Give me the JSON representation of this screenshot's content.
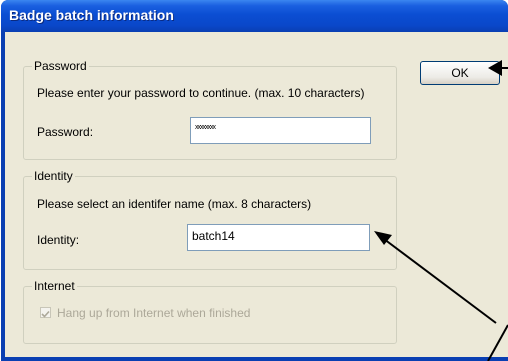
{
  "dialog": {
    "title": "Badge batch information"
  },
  "ok_button": {
    "label": "OK"
  },
  "password_group": {
    "legend": "Password",
    "instruction": "Please enter your password to continue. (max. 10 characters)",
    "field_label": "Password:",
    "value_masked": "xxxxxxxx"
  },
  "identity_group": {
    "legend": "Identity",
    "instruction": "Please select an identifer name (max. 8 characters)",
    "field_label": "Identity:",
    "value": "batch14"
  },
  "internet_group": {
    "legend": "Internet",
    "checkbox_label": "Hang up from Internet when finished",
    "checked": true,
    "enabled": false
  },
  "colors": {
    "title_bar": "#0a47c9",
    "dialog_bg": "#ece9d8",
    "field_border": "#7f9db9",
    "annotation_arrow": "#000000"
  }
}
